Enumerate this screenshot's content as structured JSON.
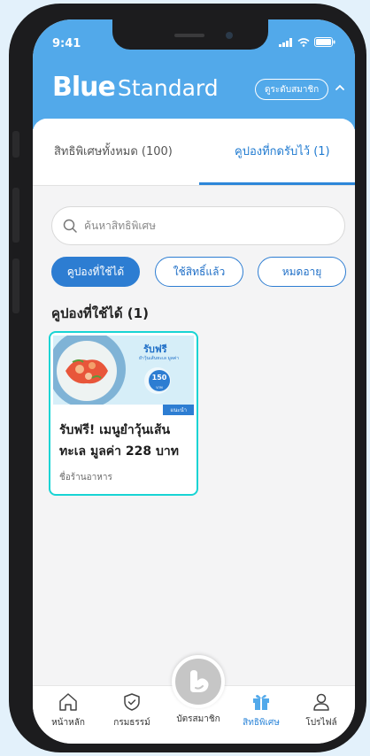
{
  "status_bar": {
    "time": "9:41"
  },
  "header": {
    "logo_mark": "Blue",
    "logo_text": "Standard",
    "membership_level_button": "ดูระดับสมาชิก"
  },
  "tabs": [
    {
      "label": "สิทธิพิเศษทั้งหมด (100)",
      "active": false
    },
    {
      "label": "คูปองที่กดรับไว้ (1)",
      "active": true
    }
  ],
  "search": {
    "placeholder": "ค้นหาสิทธิพิเศษ"
  },
  "filters": [
    {
      "label": "คูปองที่ใช้ได้",
      "active": true
    },
    {
      "label": "ใช้สิทธิ์แล้ว",
      "active": false
    },
    {
      "label": "หมดอายุ",
      "active": false
    }
  ],
  "section_title": "คูปองที่ใช้ได้ (1)",
  "coupons": [
    {
      "title": "รับฟรี! เมนูยำวุ้นเส้นทะเล มูลค่า 228 บาท",
      "shop_name": "ชื่อร้านอาหาร",
      "tag": "แนะนำ",
      "banner_headline": "รับฟรี",
      "banner_sub": "ยำวุ้นเส้นทะเล มูลค่า",
      "banner_value": "150",
      "banner_unit": "บาท"
    }
  ],
  "bottom_nav": [
    {
      "label": "หน้าหลัก",
      "icon": "home-icon",
      "active": false
    },
    {
      "label": "กรมธรรม์",
      "icon": "shield-icon",
      "active": false
    },
    {
      "label": "บัตรสมาชิก",
      "icon": "member-card-icon",
      "active": false
    },
    {
      "label": "สิทธิพิเศษ",
      "icon": "gift-icon",
      "active": true
    },
    {
      "label": "โปรไฟล์",
      "icon": "profile-icon",
      "active": false
    }
  ],
  "colors": {
    "brand_blue": "#52a9ea",
    "accent_blue": "#2d7dd2",
    "card_border": "#18d4d4"
  }
}
